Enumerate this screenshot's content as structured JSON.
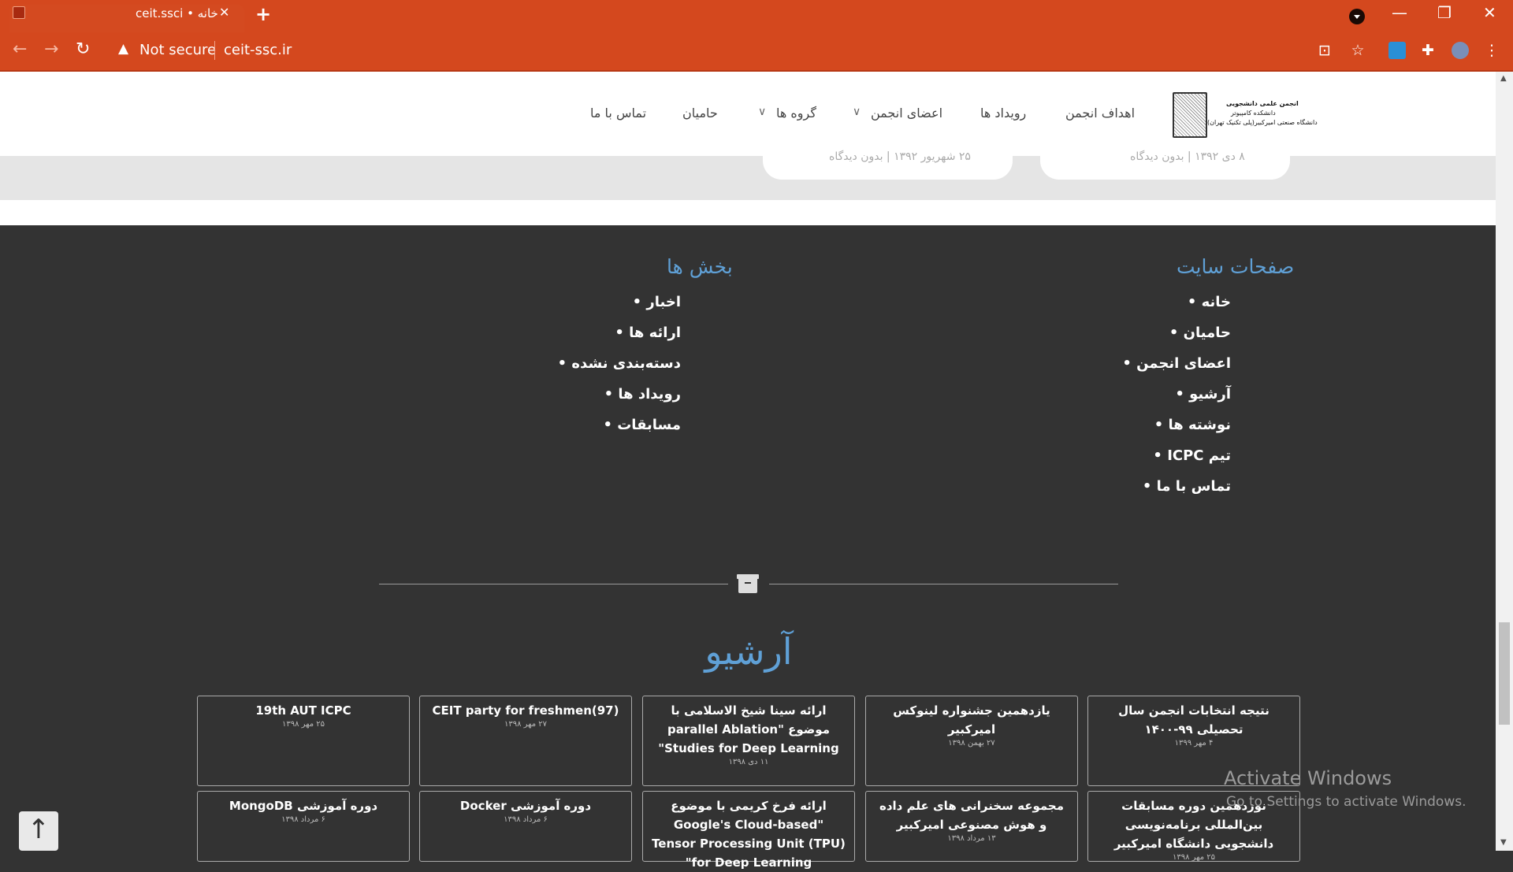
{
  "browser": {
    "tab_title": "ceit.ssci • خانه",
    "close": "✕",
    "new_tab": "+",
    "security": "Not secure",
    "url": "ceit-ssc.ir",
    "win_min": "—",
    "win_restore": "❐",
    "win_close": "✕"
  },
  "site": {
    "logo_lines": [
      "انجمن علمی دانشجویی",
      "دانشکده کامپیوتر",
      "دانشگاه صنعتی امیرکبیر(پلی تکنیک تهران)"
    ],
    "menu": [
      "اهداف انجمن",
      "رویداد ها",
      "اعضای انجمن",
      "گروه ها",
      "حامیان",
      "تماس با ما"
    ]
  },
  "posts": [
    {
      "meta": "۸ دی ۱۳۹۲  |  بدون دیدگاه"
    },
    {
      "meta": "۲۵ شهریور ۱۳۹۲  |  بدون دیدگاه"
    }
  ],
  "footer": {
    "pages_heading": "صفحات سایت",
    "pages": [
      "خانه",
      "حامیان",
      "اعضای انجمن",
      "آرشیو",
      "نوشته ها",
      "تیم ICPC",
      "تماس با ما"
    ],
    "sections_heading": "بخش ها",
    "sections": [
      "اخبار",
      "ارائه ها",
      "دسته‌بندی نشده",
      "رویداد ها",
      "مسابقات"
    ]
  },
  "archive": {
    "title": "آرشیو",
    "row1": [
      {
        "title": "نتیجه انتخابات انجمن سال تحصیلی ۹۹-۱۴۰۰",
        "date": "۴ مهر ۱۳۹۹"
      },
      {
        "title": "یازدهمین جشنواره لینوکس امیرکبیر",
        "date": "۲۷ بهمن ۱۳۹۸"
      },
      {
        "title": "ارائه سینا شیخ الاسلامی با موضوع \"parallel Ablation Studies for Deep Learning\"",
        "date": "۱۱ دی ۱۳۹۸"
      },
      {
        "title": "CEIT party for freshmen(97)",
        "date": "۲۷ مهر ۱۳۹۸"
      },
      {
        "title": "19th AUT ICPC",
        "date": "۲۵ مهر ۱۳۹۸"
      }
    ],
    "row2": [
      {
        "title": "نوزدهمین دوره مسابقات بین‌المللی برنامه‌نویسی دانشجویی دانشگاه امیرکبیر",
        "date": "۲۵ مهر ۱۳۹۸"
      },
      {
        "title": "مجموعه سخنرانی های علم داده و هوش مصنوعی امیرکبیر",
        "date": "۱۳ مرداد ۱۳۹۸"
      },
      {
        "title": "ارائه فرخ کریمی با موضوع \"Google's Cloud-based Tensor Processing Unit (TPU) for Deep Learning\"",
        "date": ""
      },
      {
        "title": "دوره آموزشی Docker",
        "date": "۶ مرداد ۱۳۹۸"
      },
      {
        "title": "دوره آموزشی MongoDB",
        "date": "۶ مرداد ۱۳۹۸"
      }
    ]
  },
  "scroll_top": "↑",
  "watermark": {
    "line1": "Activate Windows",
    "line2": "Go to Settings to activate Windows."
  }
}
